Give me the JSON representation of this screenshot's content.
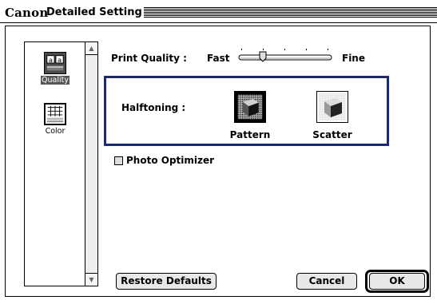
{
  "window": {
    "brand": "Canon",
    "title": "Detailed Setting"
  },
  "sidebar": {
    "items": [
      {
        "label": "Quality",
        "icon": "quality-icon",
        "selected": true
      },
      {
        "label": "Color",
        "icon": "color-icon",
        "selected": false
      }
    ]
  },
  "print_quality": {
    "label": "Print Quality :",
    "min_label": "Fast",
    "max_label": "Fine",
    "value": 0.25
  },
  "halftoning": {
    "label": "Halftoning :",
    "options": [
      {
        "label": "Pattern",
        "icon": "pattern-cube-icon",
        "selected": true
      },
      {
        "label": "Scatter",
        "icon": "scatter-cube-icon",
        "selected": false
      }
    ]
  },
  "photo_optimizer": {
    "label": "Photo Optimizer",
    "checked": false
  },
  "buttons": {
    "restore_defaults": "Restore Defaults",
    "cancel": "Cancel",
    "ok": "OK"
  },
  "colors": {
    "accent": "#1d2b6e"
  }
}
